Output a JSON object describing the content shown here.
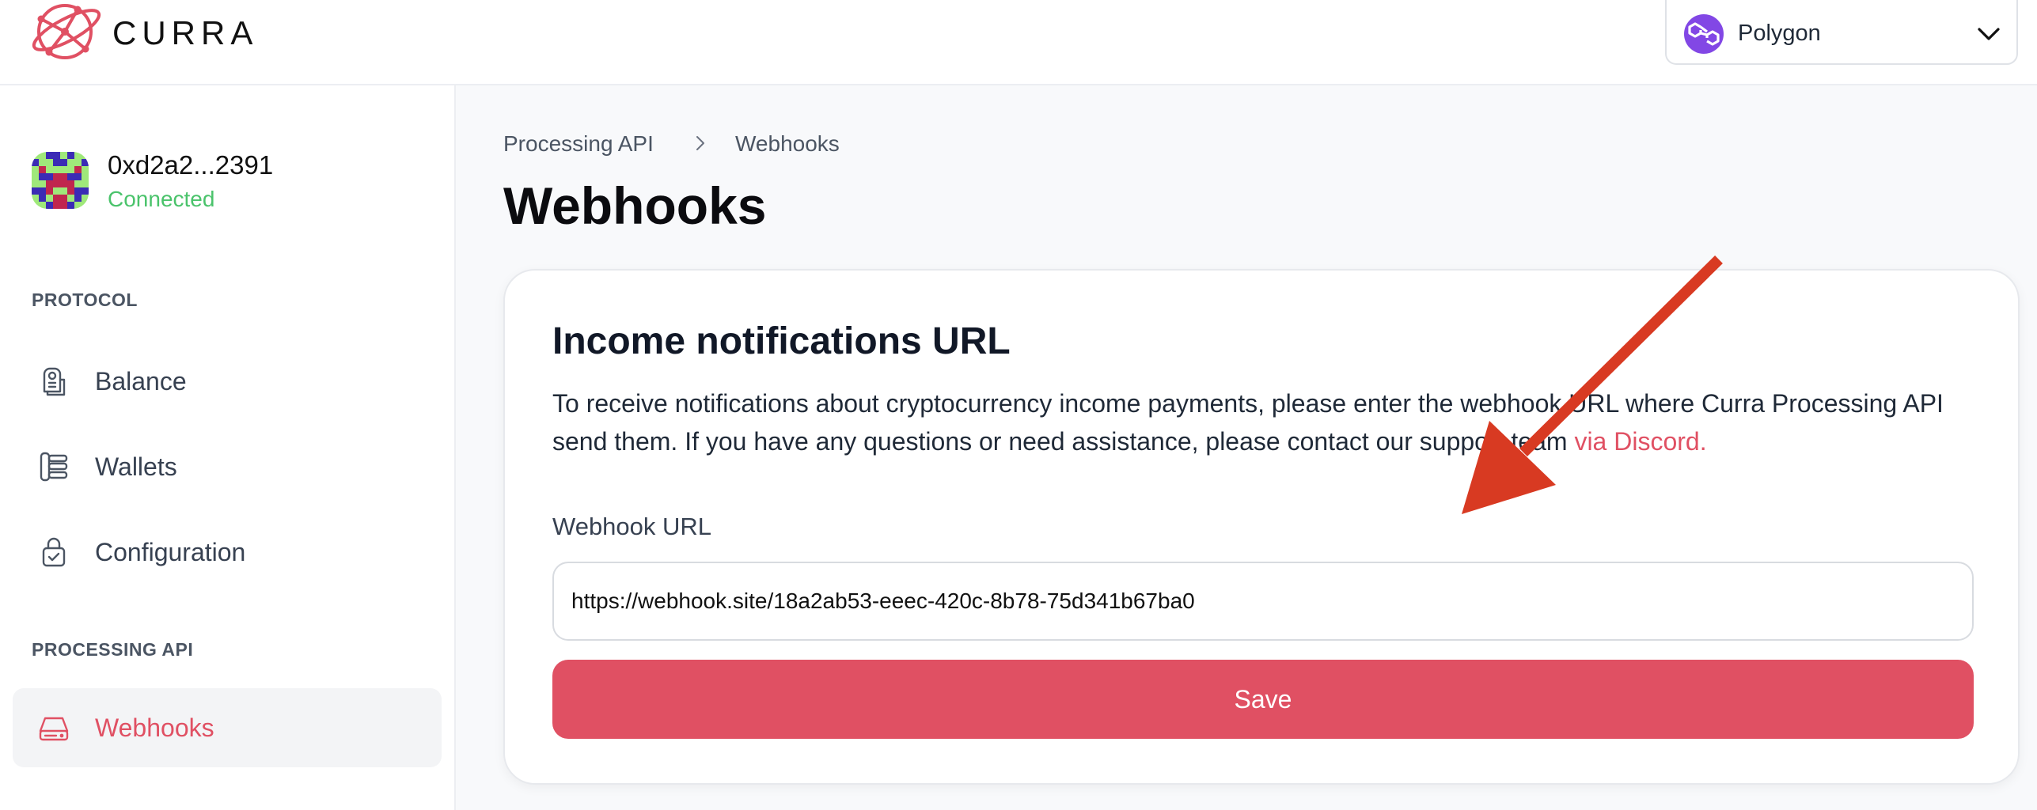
{
  "header": {
    "brand": "CURRA",
    "logo_icon": "curra-logo-icon",
    "network": {
      "label": "Polygon",
      "icon": "polygon-icon"
    }
  },
  "sidebar": {
    "account": {
      "address": "0xd2a2...2391",
      "status": "Connected"
    },
    "sections": [
      {
        "label": "PROTOCOL",
        "items": [
          {
            "label": "Balance",
            "icon": "balance-icon"
          },
          {
            "label": "Wallets",
            "icon": "wallets-icon"
          },
          {
            "label": "Configuration",
            "icon": "configuration-icon"
          }
        ]
      },
      {
        "label": "PROCESSING API",
        "items": [
          {
            "label": "Webhooks",
            "icon": "webhooks-icon",
            "active": true
          }
        ]
      }
    ]
  },
  "main": {
    "breadcrumb": [
      "Processing API",
      "Webhooks"
    ],
    "title": "Webhooks",
    "card": {
      "title": "Income notifications URL",
      "description": "To receive notifications about cryptocurrency income payments, please enter the webhook URL where Curra Processing API send them. If you have any questions or need assistance, please contact our support team ",
      "link_text": "via Discord.",
      "field_label": "Webhook URL",
      "field_value": "https://webhook.site/18a2ab53-eeec-420c-8b78-75d341b67ba0",
      "save_label": "Save"
    }
  },
  "colors": {
    "accent": "#e05063",
    "connected": "#4ac36b",
    "polygon": "#8247e5",
    "annotation_arrow": "#d83a22"
  }
}
